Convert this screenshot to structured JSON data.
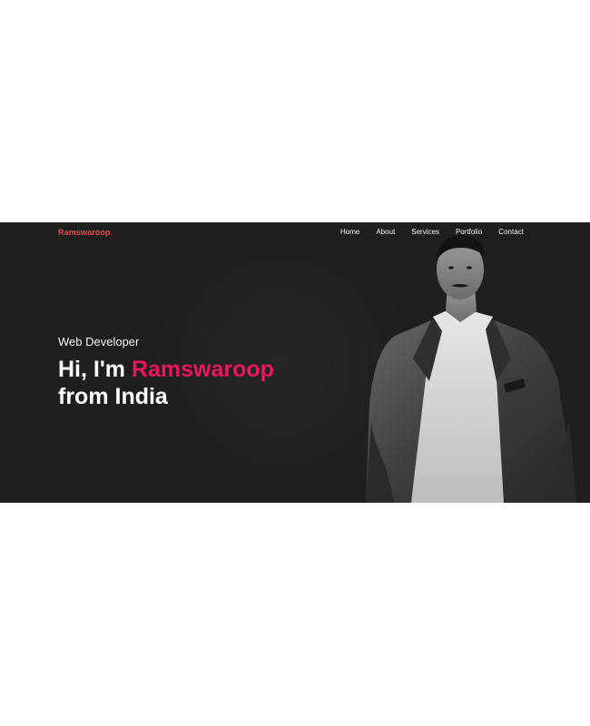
{
  "brand": {
    "name": "Ramswaroop",
    "dot": "."
  },
  "nav": {
    "items": [
      "Home",
      "About",
      "Services",
      "Portfolio",
      "Contact"
    ]
  },
  "hero": {
    "subtitle": "Web Developer",
    "greeting": "Hi, I'm ",
    "name": "Ramswaroop",
    "line2": "from India",
    "photo_alt_icon": "person-portrait-icon"
  },
  "colors": {
    "background": "#1f1f1f",
    "accent": "#ec1560",
    "logo": "#e14b4b",
    "text": "#ffffff"
  }
}
